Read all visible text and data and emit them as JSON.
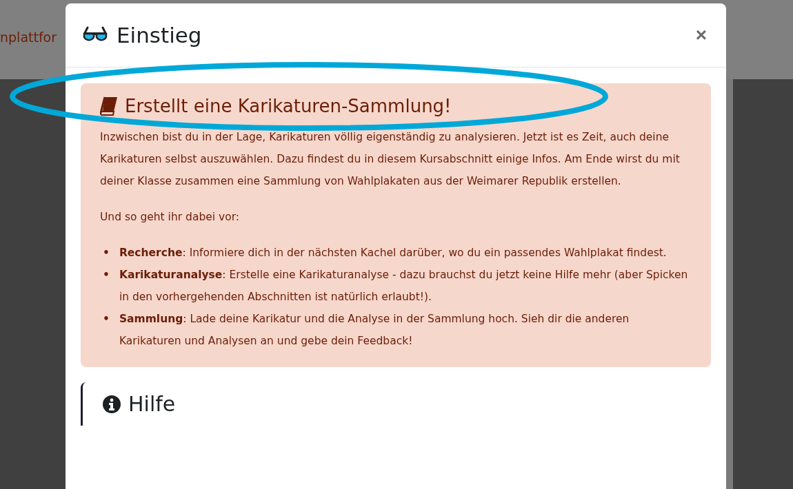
{
  "background": {
    "header_text": "nplattfor"
  },
  "modal": {
    "title": "Einstieg",
    "close": "×",
    "alert": {
      "heading": "Erstellt eine Karikaturen-Sammlung!",
      "paragraphs": [
        "Inzwischen bist du in der Lage, Karikaturen völlig eigenständig zu analysieren. Jetzt ist es Zeit, auch deine Karikaturen selbst auszuwählen. Dazu findest du in diesem Kursabschnitt einige Infos. Am Ende wirst du mit deiner Klasse zusammen eine Sammlung von Wahlplakaten aus der Weimarer Republik erstellen.",
        "Und so geht ihr dabei vor:"
      ],
      "bullet": "•",
      "steps": [
        "**Recherche**: Informiere dich in der nächsten Kachel darüber, wo du ein passendes Wahlplakat findest.",
        "**Karikaturanalyse**: Erstelle eine Karikaturanalyse - dazu brauchst du jetzt keine Hilfe mehr (aber Spicken in den vorhergehenden Abschnitten ist natürlich erlaubt!).",
        "**Sammlung**: Lade deine Karikatur und die Analyse in der Sammlung hoch. Sieh dir die anderen Karikaturen und Analysen an und gebe dein Feedback!"
      ]
    },
    "help": {
      "heading": "Hilfe"
    }
  },
  "annotation": {
    "kind": "ellipse"
  }
}
